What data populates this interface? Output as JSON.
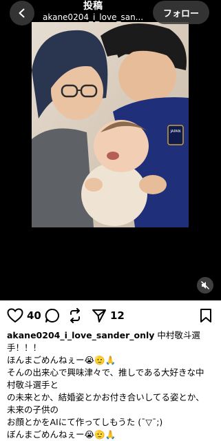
{
  "header": {
    "title": "投稿",
    "username": "akane0204_i_love_san...",
    "follow_label": "フォロー"
  },
  "icons": {
    "back": "chevron-left-icon",
    "mute": "speaker-muted-icon",
    "like": "heart-icon",
    "comment": "comment-icon",
    "repost": "repost-icon",
    "share": "send-icon",
    "save": "bookmark-icon"
  },
  "actions": {
    "likes": "40",
    "shares": "12"
  },
  "caption": {
    "username": "akane0204_i_love_sander_only",
    "first_text": " 中村敬斗選",
    "lines": [
      "手！！！",
      "ほんまごめんねぇー😭🫡🙏",
      "そんの出来心で興味津々で、推しである大好きな中",
      "村敬斗選手と",
      "の未来とか、結婚姿とかお付き合いしてる姿とか、",
      "未来の子供の",
      "お顔とかをAIにて作ってしもうた (¯▽¯;)",
      "ぼんまごめんねぇー😭🫡🙏"
    ]
  },
  "photo": {
    "jersey_text": "JAPAN"
  },
  "colors": {
    "media_background": "#000000",
    "page_background": "#ffffff",
    "jersey_blue": "#1f2f7a",
    "wall_beige": "#d9cdbf"
  }
}
